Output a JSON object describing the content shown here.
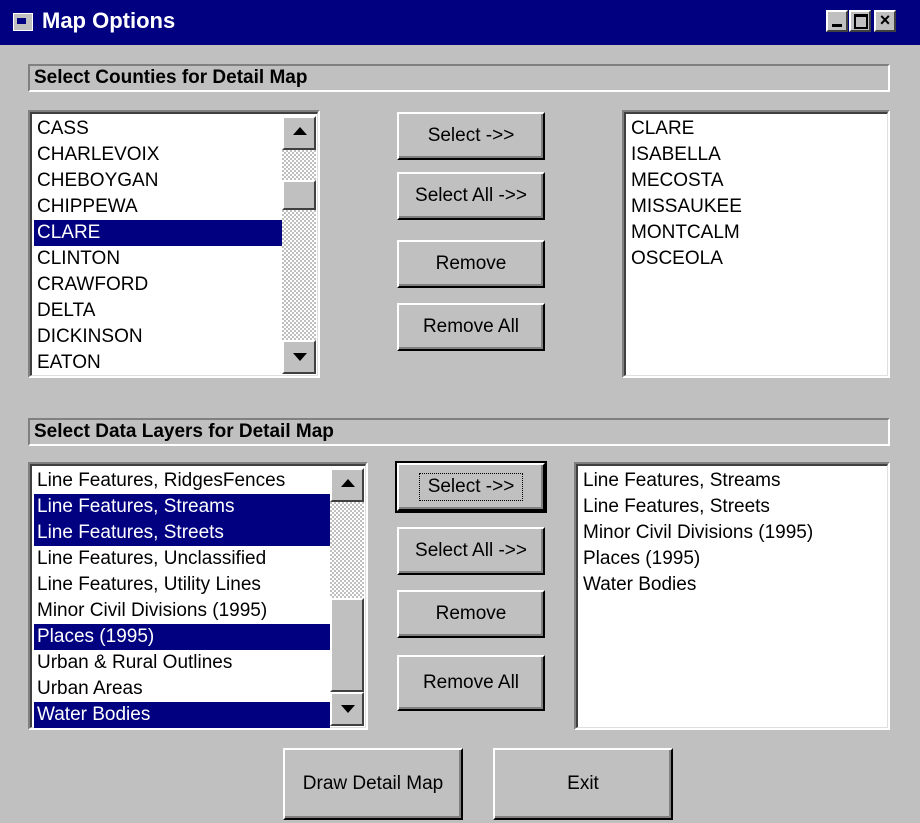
{
  "window": {
    "title": "Map Options"
  },
  "counties": {
    "heading": "Select Counties for Detail Map",
    "available": [
      {
        "label": "CASS",
        "selected": false
      },
      {
        "label": "CHARLEVOIX",
        "selected": false
      },
      {
        "label": "CHEBOYGAN",
        "selected": false
      },
      {
        "label": "CHIPPEWA",
        "selected": false
      },
      {
        "label": "CLARE",
        "selected": true
      },
      {
        "label": "CLINTON",
        "selected": false
      },
      {
        "label": "CRAWFORD",
        "selected": false
      },
      {
        "label": "DELTA",
        "selected": false
      },
      {
        "label": "DICKINSON",
        "selected": false
      },
      {
        "label": "EATON",
        "selected": false
      }
    ],
    "chosen": [
      "CLARE",
      "ISABELLA",
      "MECOSTA",
      "MISSAUKEE",
      "MONTCALM",
      "OSCEOLA"
    ],
    "buttons": {
      "select": "Select ->>",
      "select_all": "Select All ->>",
      "remove": "Remove",
      "remove_all": "Remove All"
    }
  },
  "layers": {
    "heading": "Select Data Layers for Detail Map",
    "available": [
      {
        "label": "Line Features, RidgesFences",
        "selected": false
      },
      {
        "label": "Line Features, Streams",
        "selected": true
      },
      {
        "label": "Line Features, Streets",
        "selected": true
      },
      {
        "label": "Line Features, Unclassified",
        "selected": false
      },
      {
        "label": "Line Features, Utility Lines",
        "selected": false
      },
      {
        "label": "Minor Civil Divisions (1995)",
        "selected": false
      },
      {
        "label": "Places (1995)",
        "selected": true
      },
      {
        "label": "Urban & Rural Outlines",
        "selected": false
      },
      {
        "label": "Urban Areas",
        "selected": false
      },
      {
        "label": "Water Bodies",
        "selected": true
      }
    ],
    "chosen": [
      "Line Features, Streams",
      "Line Features, Streets",
      "Minor Civil Divisions (1995)",
      "Places (1995)",
      "Water Bodies"
    ],
    "buttons": {
      "select": "Select ->>",
      "select_all": "Select All ->>",
      "remove": "Remove",
      "remove_all": "Remove All"
    }
  },
  "footer": {
    "draw": "Draw Detail Map",
    "exit": "Exit"
  },
  "colors": {
    "titlebar": "#000080",
    "selection": "#000080",
    "face": "#c0c0c0"
  }
}
